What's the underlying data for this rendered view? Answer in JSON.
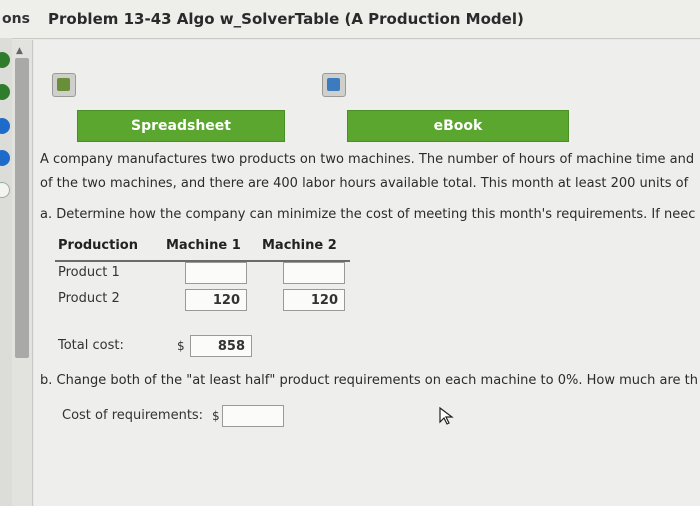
{
  "header": {
    "left_fragment": "ons",
    "title": "Problem 13-43 Algo w_SolverTable (A Production Model)"
  },
  "buttons": {
    "spreadsheet": "Spreadsheet",
    "ebook": "eBook"
  },
  "intro": {
    "line1": "A company manufactures two products on two machines. The number of hours of machine time and",
    "line2": "of the two machines, and there are 400 labor hours available total. This month at least 200 units of"
  },
  "part_a": {
    "text": "a. Determine how the company can minimize the cost of meeting this month's requirements. If neec"
  },
  "table": {
    "headers": [
      "Production",
      "Machine 1",
      "Machine 2"
    ],
    "rows": [
      {
        "label": "Product 1",
        "m1": "",
        "m2": ""
      },
      {
        "label": "Product 2",
        "m1": "120",
        "m2": "120"
      }
    ]
  },
  "total": {
    "label": "Total cost:",
    "currency": "$",
    "value": "858"
  },
  "part_b": {
    "text": "b. Change both of the \"at least half\" product requirements on each machine to 0%. How much are th",
    "cost_label": "Cost of requirements:",
    "currency": "$",
    "value": ""
  },
  "colors": {
    "button_green": "#5aa62e",
    "nav_green": "#2f7d2c",
    "nav_blue": "#1f6bc9"
  }
}
